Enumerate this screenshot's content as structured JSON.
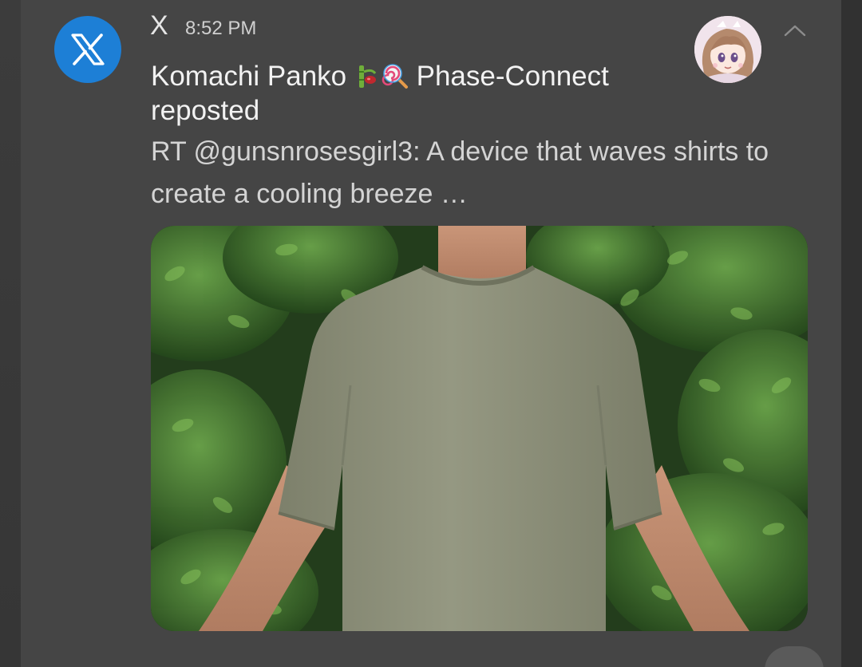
{
  "notification": {
    "app_name": "X",
    "time": "8:52 PM",
    "title_prefix": "Komachi Panko",
    "title_suffix": "Phase-Connect",
    "title_line2": "reposted",
    "body": "RT @gunsnrosesgirl3: A device that waves shirts to create a cooling breeze …",
    "icons": {
      "app": "x-logo-icon",
      "avatar": "anime-avatar",
      "collapse": "chevron-up-icon",
      "emoji1": "bamboo-emoji-icon",
      "emoji2": "lollipop-emoji-icon"
    },
    "media": {
      "kind": "photo",
      "subject": "person-in-olive-tshirt"
    }
  },
  "colors": {
    "card_bg": "#454545",
    "app_icon_bg": "#1d7fd6",
    "title_text": "#f2f2f2",
    "body_text": "#d4d4d4",
    "shirt": "#8d9079"
  }
}
